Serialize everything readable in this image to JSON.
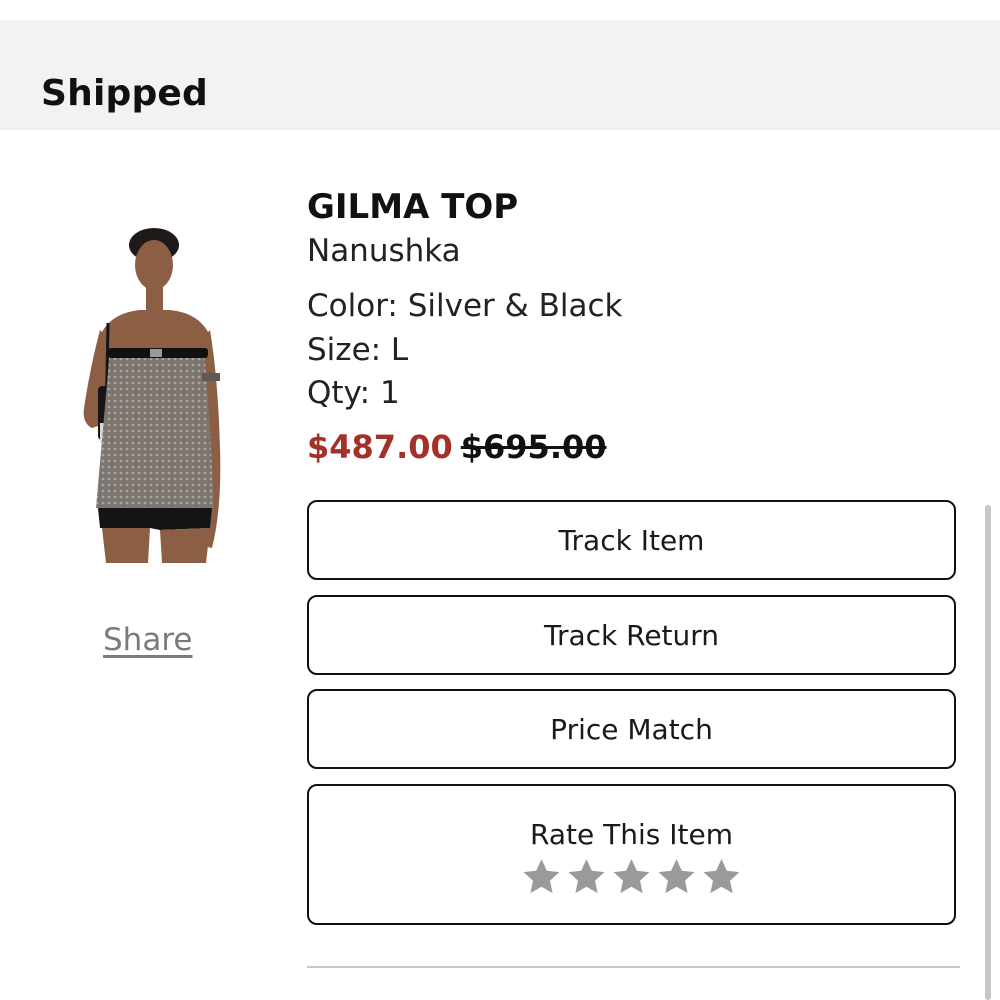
{
  "status": {
    "title": "Shipped"
  },
  "product": {
    "name": "GILMA TOP",
    "brand": "Nanushka",
    "color": "Color: Silver & Black",
    "size": "Size: L",
    "qty": "Qty: 1",
    "sale_price": "$487.00",
    "original_price": "$695.00",
    "image_icon": "model-wearing-silver-mesh-tube-top-image"
  },
  "share": {
    "label": "Share"
  },
  "actions": {
    "track_item": "Track Item",
    "track_return": "Track Return",
    "price_match": "Price Match"
  },
  "rating": {
    "label": "Rate This Item",
    "stars": 5,
    "selected": 0,
    "star_icon": "star-icon"
  },
  "colors": {
    "sale_price": "#a4302a",
    "status_bar_bg": "#f2f2f2",
    "star_empty": "#9a9a9a",
    "share_link": "#7a7a7a"
  }
}
